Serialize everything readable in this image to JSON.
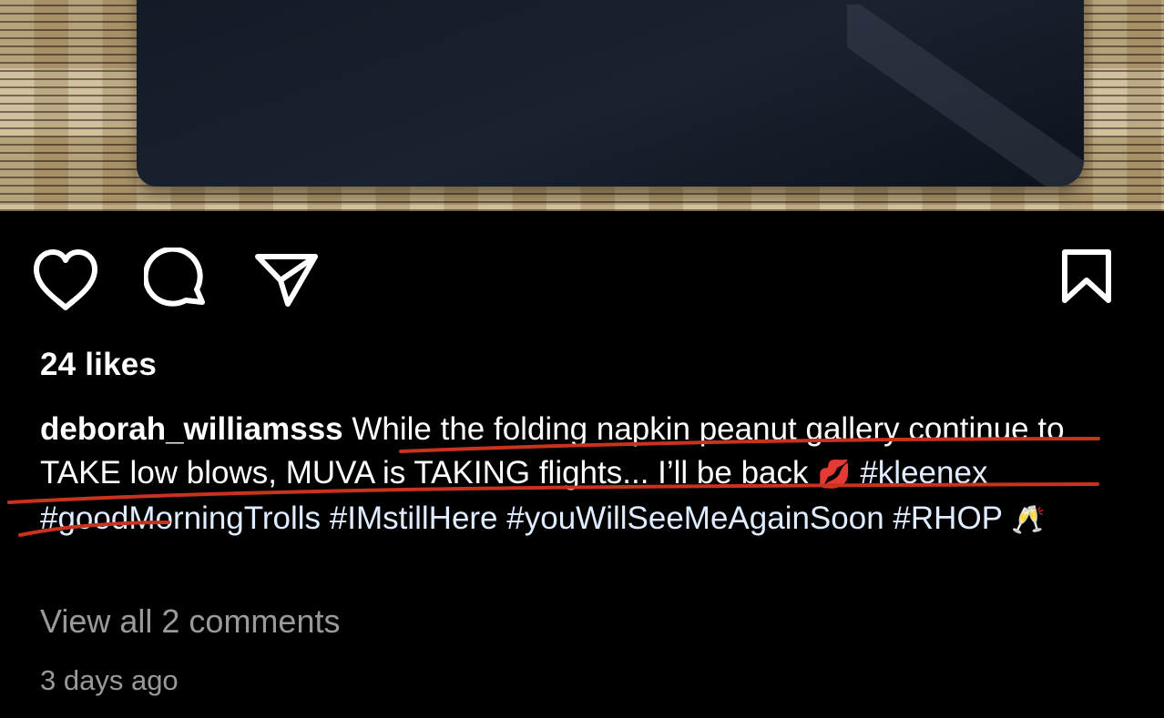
{
  "post": {
    "likes_text": "24 likes",
    "username": "deborah_williamsss",
    "caption_parts": {
      "text_line": "While the folding napkin peanut gallery continue to TAKE low blows, MUVA is TAKING flights... I’ll be back",
      "emoji_kiss": "💋",
      "tags": [
        "#kleenex",
        "#goodMorningTrolls",
        "#IMstillHere",
        "#youWillSeeMeAgainSoon",
        "#RHOP"
      ],
      "emoji_cheers": "🥂"
    },
    "view_comments_text": "View all 2 comments",
    "timestamp_text": "3 days ago"
  },
  "icons": {
    "like": "heart-icon",
    "comment": "speech-bubble-icon",
    "share": "paper-plane-icon",
    "save": "bookmark-icon"
  },
  "colors": {
    "background": "#000000",
    "text": "#ffffff",
    "muted_text": "#9a9a9a",
    "annotation_red": "#c8321f"
  }
}
